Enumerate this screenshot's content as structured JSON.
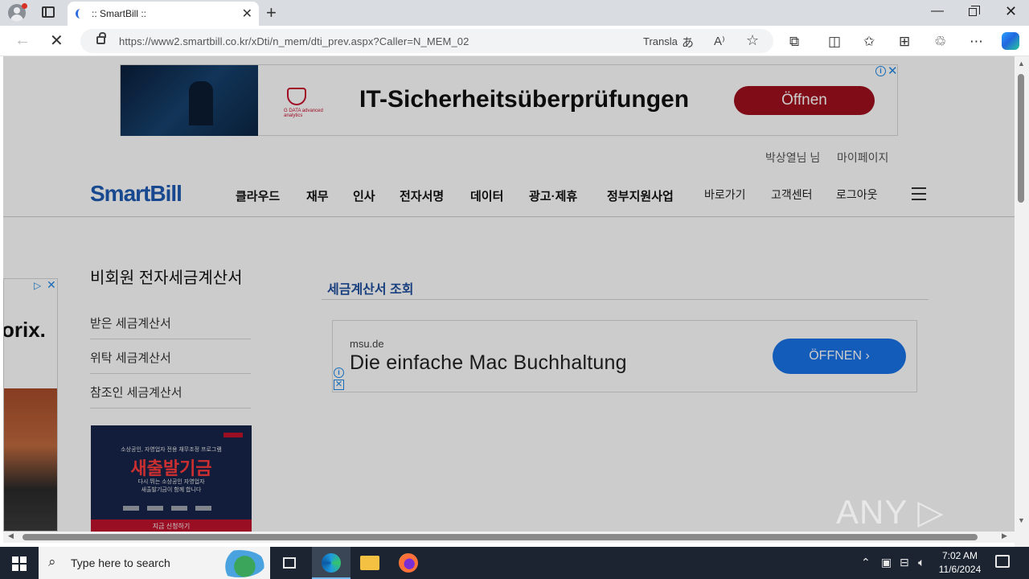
{
  "browser": {
    "tab_title": ":: SmartBill ::",
    "url": "https://www2.smartbill.co.kr/xDti/n_mem/dti_prev.aspx?Caller=N_MEM_02",
    "translate_label": "Transla"
  },
  "top_ad": {
    "headline": "IT-Sicherheitsüberprüfungen",
    "button": "Öffnen",
    "brand": "G DATA",
    "brand_sub": "advanced analytics"
  },
  "util_links": {
    "user": "박상열님 님",
    "mypage": "마이페이지"
  },
  "header": {
    "logo": "SmartBill",
    "nav": [
      "클라우드",
      "재무",
      "인사",
      "전자서명",
      "데이터",
      "광고·제휴",
      "정부지원사업"
    ],
    "util_nav": [
      "바로가기",
      "고객센터",
      "로그아웃"
    ]
  },
  "side_ad": {
    "brand": "orix."
  },
  "sidebar": {
    "title": "비회원 전자세금계산서",
    "items": [
      "받은 세금계산서",
      "위탁 세금계산서",
      "참조인 세금계산서"
    ],
    "promo": {
      "small": "소상공인, 자영업자 전용 채무조정 프로그램",
      "big": "새출발기금",
      "desc_1": "다시 뛰는 소상공인 자영업자",
      "desc_2": "새출발기금이 함께 합니다",
      "button": "지금 신청하기"
    }
  },
  "content": {
    "title": "세금계산서 조회",
    "ad": {
      "domain": "msu.de",
      "headline": "Die einfache Mac Buchhaltung",
      "button": "ÖFFNEN ›"
    }
  },
  "watermark": "ANY ▷ RUN",
  "taskbar": {
    "search_placeholder": "Type here to search",
    "time": "7:02 AM",
    "date": "11/6/2024"
  }
}
